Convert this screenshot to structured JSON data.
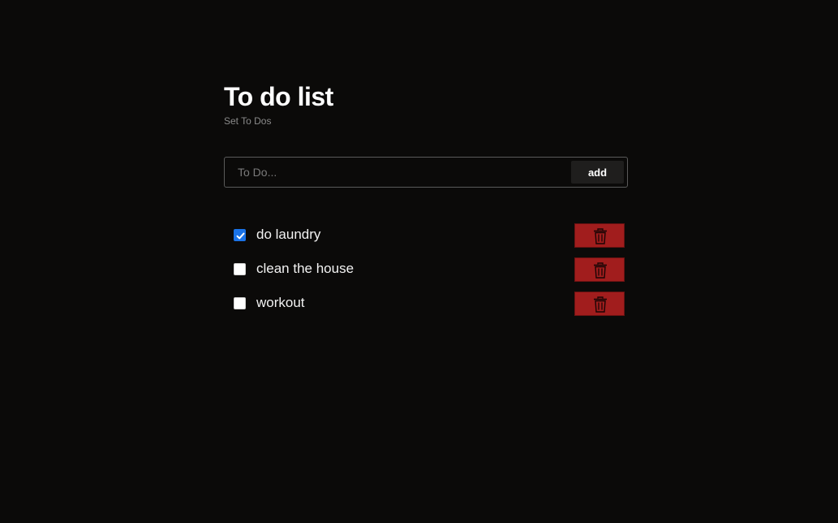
{
  "header": {
    "title": "To do list",
    "subtitle": "Set To Dos"
  },
  "form": {
    "placeholder": "To Do...",
    "value": "",
    "add_label": "add"
  },
  "todos": [
    {
      "text": "do laundry",
      "checked": true
    },
    {
      "text": "clean the house",
      "checked": false
    },
    {
      "text": "workout",
      "checked": false
    }
  ],
  "icons": {
    "checkbox_check": "check-icon",
    "delete": "trash-icon"
  },
  "colors": {
    "background": "#0b0a09",
    "delete_button": "#a11d1d",
    "checkbox_checked": "#1a73e8",
    "add_button": "#1f1e1d"
  }
}
